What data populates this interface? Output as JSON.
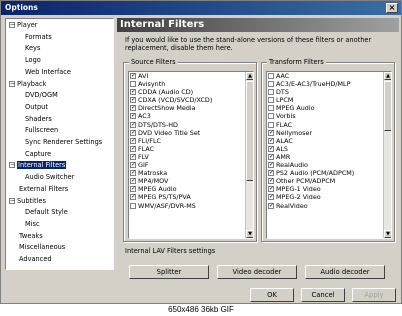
{
  "window": {
    "title": "Options",
    "close_glyph": "×"
  },
  "tree": [
    {
      "label": "Player",
      "level": 0,
      "toggle": "−"
    },
    {
      "label": "Formats",
      "level": 2
    },
    {
      "label": "Keys",
      "level": 2
    },
    {
      "label": "Logo",
      "level": 2
    },
    {
      "label": "Web Interface",
      "level": 2
    },
    {
      "label": "Playback",
      "level": 0,
      "toggle": "−"
    },
    {
      "label": "DVD/OGM",
      "level": 2
    },
    {
      "label": "Output",
      "level": 2
    },
    {
      "label": "Shaders",
      "level": 2
    },
    {
      "label": "Fullscreen",
      "level": 2
    },
    {
      "label": "Sync Renderer Settings",
      "level": 2
    },
    {
      "label": "Capture",
      "level": 2
    },
    {
      "label": "Internal Filters",
      "level": 0,
      "toggle": "−",
      "selected": true
    },
    {
      "label": "Audio Switcher",
      "level": 2
    },
    {
      "label": "External Filters",
      "level": 1
    },
    {
      "label": "Subtitles",
      "level": 0,
      "toggle": "−"
    },
    {
      "label": "Default Style",
      "level": 2
    },
    {
      "label": "Misc",
      "level": 2
    },
    {
      "label": "Tweaks",
      "level": 1
    },
    {
      "label": "Miscellaneous",
      "level": 1
    },
    {
      "label": "Advanced",
      "level": 1
    }
  ],
  "header": {
    "title": "Internal Filters"
  },
  "description": "If you would like to use the stand-alone versions of these filters or another replacement, disable them here.",
  "source_filters": {
    "title": "Source Filters",
    "items": [
      {
        "label": "AVI",
        "checked": true
      },
      {
        "label": "Avisynth",
        "checked": false
      },
      {
        "label": "CDDA (Audio CD)",
        "checked": true
      },
      {
        "label": "CDXA (VCD/SVCD/XCD)",
        "checked": true
      },
      {
        "label": "DirectShow Media",
        "checked": true
      },
      {
        "label": "AC3",
        "checked": true
      },
      {
        "label": "DTS/DTS-HD",
        "checked": true
      },
      {
        "label": "DVD Video Title Set",
        "checked": true
      },
      {
        "label": "FLI/FLC",
        "checked": true
      },
      {
        "label": "FLAC",
        "checked": true
      },
      {
        "label": "FLV",
        "checked": true
      },
      {
        "label": "GIF",
        "checked": true
      },
      {
        "label": "Matroska",
        "checked": true
      },
      {
        "label": "MP4/MOV",
        "checked": true
      },
      {
        "label": "MPEG Audio",
        "checked": true
      },
      {
        "label": "MPEG PS/TS/PVA",
        "checked": true
      },
      {
        "label": "WMV/ASF/DVR-MS",
        "checked": false
      }
    ]
  },
  "transform_filters": {
    "title": "Transform Filters",
    "items": [
      {
        "label": "AAC",
        "checked": false
      },
      {
        "label": "AC3/E-AC3/TrueHD/MLP",
        "checked": false
      },
      {
        "label": "DTS",
        "checked": false
      },
      {
        "label": "LPCM",
        "checked": false
      },
      {
        "label": "MPEG Audio",
        "checked": false
      },
      {
        "label": "Vorbis",
        "checked": false
      },
      {
        "label": "FLAC",
        "checked": false
      },
      {
        "label": "Nellymoser",
        "checked": true
      },
      {
        "label": "ALAC",
        "checked": true
      },
      {
        "label": "ALS",
        "checked": true
      },
      {
        "label": "AMR",
        "checked": true
      },
      {
        "label": "RealAudio",
        "checked": true
      },
      {
        "label": "PS2 Audio (PCM/ADPCM)",
        "checked": true
      },
      {
        "label": "Other PCM/ADPCM",
        "checked": true
      },
      {
        "label": "MPEG-1 Video",
        "checked": true
      },
      {
        "label": "MPEG-2 Video",
        "checked": true
      },
      {
        "label": "RealVideo",
        "checked": true
      }
    ]
  },
  "lav": {
    "title": "Internal LAV Filters settings",
    "splitter": "Splitter",
    "video_decoder": "Video decoder",
    "audio_decoder": "Audio decoder"
  },
  "footer": {
    "ok": "OK",
    "cancel": "Cancel",
    "apply": "Apply"
  },
  "image_caption": "650x486 36kb GIF"
}
